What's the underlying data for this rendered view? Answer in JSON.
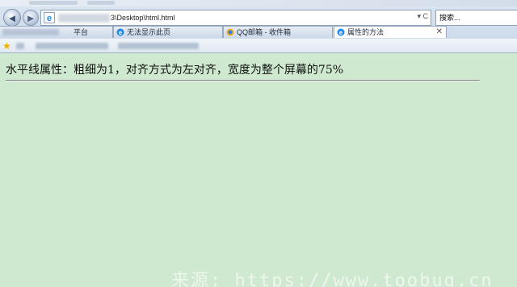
{
  "browser": {
    "address": {
      "url_text": "3\\Desktop\\html.html",
      "controls": "▾ C"
    },
    "search_placeholder": "搜索...",
    "tabs": [
      {
        "label": "平台",
        "active": false,
        "icon": "page-icon"
      },
      {
        "label": "无法显示此页",
        "active": false,
        "icon": "ie-icon"
      },
      {
        "label": "QQ邮箱 - 收件箱",
        "active": false,
        "icon": "qq-mail-icon"
      },
      {
        "label": "属性的方法",
        "active": true,
        "icon": "ie-icon"
      }
    ],
    "active_tab_close": "✕"
  },
  "page": {
    "heading": "水平线属性：粗细为1，对齐方式为左对齐，宽度为整个屏幕的75%",
    "hr": {
      "size": 1,
      "align": "left",
      "width_fraction": 0.75
    }
  },
  "watermark": "来源: https://www.toobug.cn",
  "colors": {
    "page_background": "#cfe8d0",
    "ie_blue": "#1e88e5",
    "favorite_star": "#f0b400"
  }
}
